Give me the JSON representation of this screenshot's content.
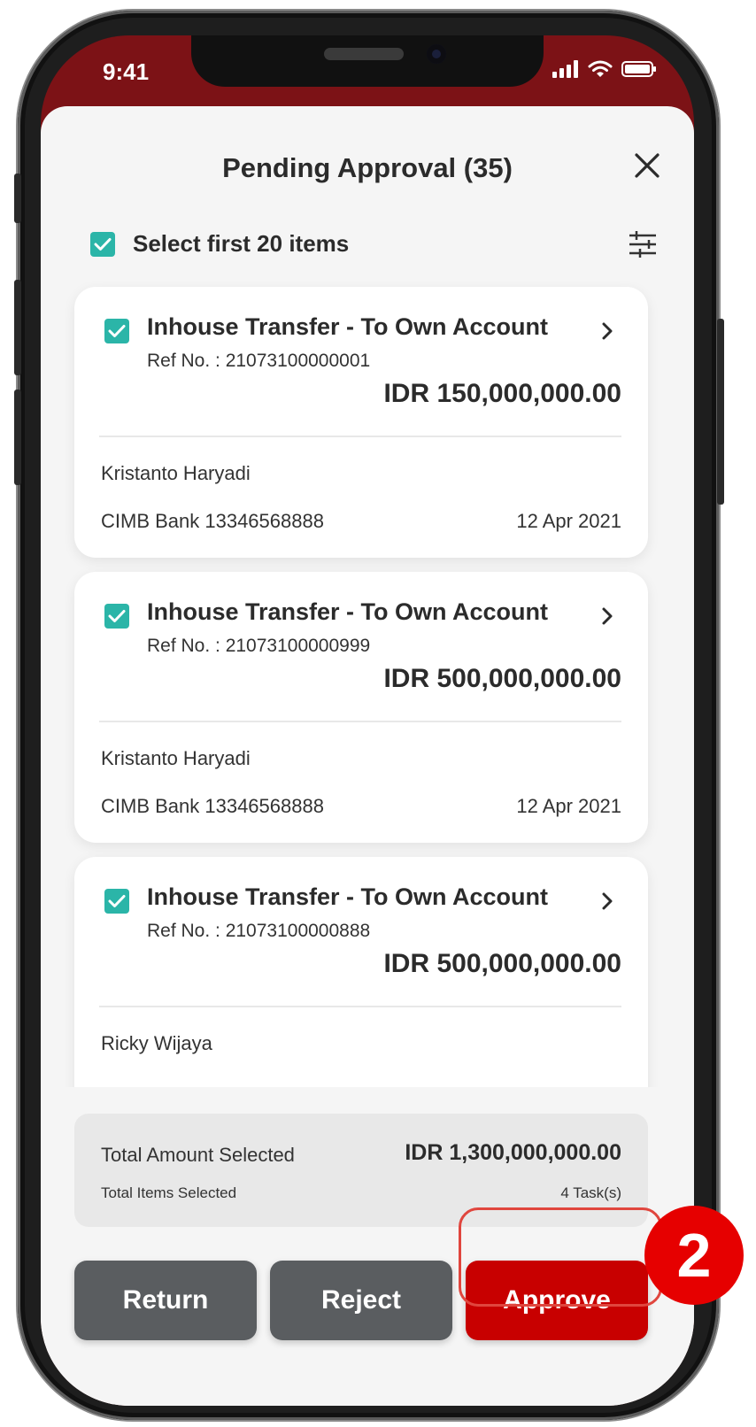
{
  "status_bar": {
    "time": "9:41"
  },
  "header": {
    "title": "Pending Approval (35)"
  },
  "select_all": {
    "label": "Select first 20 items"
  },
  "cards": [
    {
      "title": "Inhouse Transfer - To Own Account",
      "ref": "Ref No. : 21073100000001",
      "amount": "IDR 150,000,000.00",
      "name": "Kristanto Haryadi",
      "bank": "CIMB Bank 13346568888",
      "date": "12 Apr 2021"
    },
    {
      "title": "Inhouse Transfer - To Own Account",
      "ref": "Ref No. : 21073100000999",
      "amount": "IDR 500,000,000.00",
      "name": "Kristanto Haryadi",
      "bank": "CIMB Bank 13346568888",
      "date": "12 Apr 2021"
    },
    {
      "title": "Inhouse Transfer - To Own Account",
      "ref": "Ref No. : 21073100000888",
      "amount": "IDR 500,000,000.00",
      "name": "Ricky Wijaya",
      "bank": "",
      "date": ""
    }
  ],
  "totals": {
    "amount_label": "Total Amount Selected",
    "amount_value": "IDR 1,300,000,000.00",
    "items_label": "Total Items Selected",
    "items_value": "4 Task(s)"
  },
  "actions": {
    "return_label": "Return",
    "reject_label": "Reject",
    "approve_label": "Approve"
  },
  "step_badge": "2",
  "colors": {
    "brand_red": "#c80000",
    "header_maroon": "#7c1216",
    "check_teal": "#2bb5a8",
    "neutral_button": "#5a5d60",
    "badge_red": "#e60000"
  },
  "icons": [
    "close-icon",
    "checkbox-checked-icon",
    "filter-icon",
    "chevron-right-icon",
    "signal-icon",
    "wifi-icon",
    "battery-icon"
  ]
}
